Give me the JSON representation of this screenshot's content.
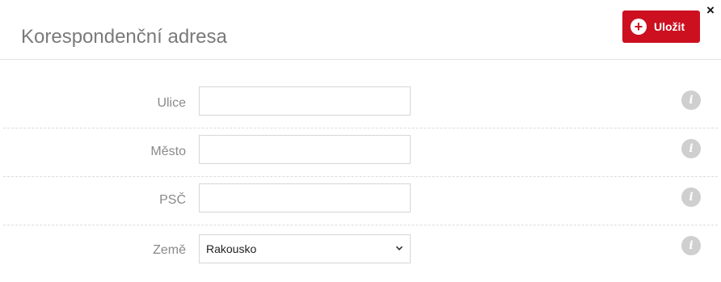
{
  "dialog": {
    "title": "Korespondenční adresa",
    "close_label": "×",
    "save_label": "Uložit",
    "save_icon": "+",
    "accent_color": "#cc1020"
  },
  "form": {
    "fields": [
      {
        "label": "Ulice",
        "value": "",
        "type": "text"
      },
      {
        "label": "Město",
        "value": "",
        "type": "text"
      },
      {
        "label": "PSČ",
        "value": "",
        "type": "text"
      },
      {
        "label": "Země",
        "value": "Rakousko",
        "type": "select"
      }
    ],
    "info_icon": "i"
  }
}
